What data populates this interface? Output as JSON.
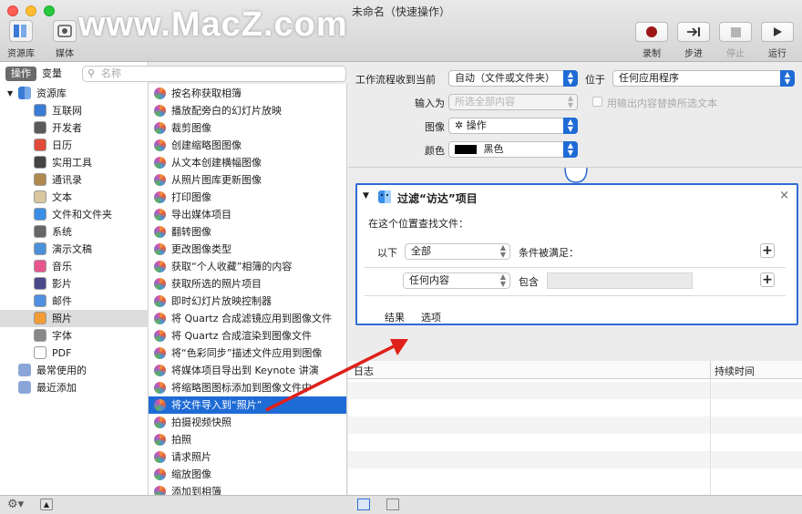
{
  "window": {
    "title": "未命名（快速操作）",
    "watermark": "www.MacZ.com"
  },
  "toolbar": {
    "left_buttons": [
      {
        "label": "资源库",
        "icon": "library-icon"
      },
      {
        "label": "媒体",
        "icon": "media-icon"
      }
    ],
    "right_buttons": [
      {
        "label": "录制",
        "icon": "record-icon"
      },
      {
        "label": "步进",
        "icon": "step-icon"
      },
      {
        "label": "停止",
        "icon": "stop-icon"
      },
      {
        "label": "运行",
        "icon": "run-icon"
      }
    ]
  },
  "library": {
    "tabs": [
      "操作",
      "变量"
    ],
    "search_placeholder": "名称",
    "root": "资源库",
    "items": [
      {
        "label": "互联网",
        "icon": "internet-icon",
        "color": "#3a7bd5"
      },
      {
        "label": "开发者",
        "icon": "developer-icon",
        "color": "#5a5a5a"
      },
      {
        "label": "日历",
        "icon": "calendar-icon",
        "color": "#e04b3a"
      },
      {
        "label": "实用工具",
        "icon": "utilities-icon",
        "color": "#444"
      },
      {
        "label": "通讯录",
        "icon": "contacts-icon",
        "color": "#b0894f"
      },
      {
        "label": "文本",
        "icon": "text-icon",
        "color": "#d9c7a0"
      },
      {
        "label": "文件和文件夹",
        "icon": "finder-icon",
        "color": "#3a8ee6"
      },
      {
        "label": "系统",
        "icon": "system-icon",
        "color": "#666"
      },
      {
        "label": "演示文稿",
        "icon": "presentation-icon",
        "color": "#4a90d9"
      },
      {
        "label": "音乐",
        "icon": "music-icon",
        "color": "#e8558e"
      },
      {
        "label": "影片",
        "icon": "movies-icon",
        "color": "#4a4a8a"
      },
      {
        "label": "邮件",
        "icon": "mail-icon",
        "color": "#4f8fe0"
      },
      {
        "label": "照片",
        "icon": "photos-icon",
        "color": "#f29c38",
        "selected": true
      },
      {
        "label": "字体",
        "icon": "fonts-icon",
        "color": "#888"
      },
      {
        "label": "PDF",
        "icon": "pdf-icon",
        "color": "#ffffff"
      }
    ],
    "smart": [
      {
        "label": "最常使用的",
        "icon": "smart-folder-icon"
      },
      {
        "label": "最近添加",
        "icon": "smart-folder-icon"
      }
    ]
  },
  "actions": {
    "items": [
      {
        "label": "按名称获取相簿"
      },
      {
        "label": "播放配旁白的幻灯片放映"
      },
      {
        "label": "裁剪图像"
      },
      {
        "label": "创建缩略图图像"
      },
      {
        "label": "从文本创建横幅图像"
      },
      {
        "label": "从照片图库更新图像"
      },
      {
        "label": "打印图像"
      },
      {
        "label": "导出媒体项目"
      },
      {
        "label": "翻转图像"
      },
      {
        "label": "更改图像类型"
      },
      {
        "label": "获取“个人收藏”相簿的内容"
      },
      {
        "label": "获取所选的照片项目"
      },
      {
        "label": "即时幻灯片放映控制器"
      },
      {
        "label": "将 Quartz 合成滤镜应用到图像文件"
      },
      {
        "label": "将 Quartz 合成渲染到图像文件"
      },
      {
        "label": "将“色彩同步”描述文件应用到图像"
      },
      {
        "label": "将媒体项目导出到 Keynote 讲演"
      },
      {
        "label": "将缩略图图标添加到图像文件中"
      },
      {
        "label": "将文件导入到“照片”",
        "selected": true
      },
      {
        "label": "拍摄视频快照"
      },
      {
        "label": "拍照"
      },
      {
        "label": "请求照片"
      },
      {
        "label": "缩放图像"
      },
      {
        "label": "添加到相簿"
      }
    ]
  },
  "workflow": {
    "receives_label": "工作流程收到当前",
    "receives_value": "自动（文件或文件夹）",
    "in_label": "位于",
    "in_value": "任何应用程序",
    "input_label": "输入为",
    "input_value": "所选全部内容",
    "replace_label": "用输出内容替换所选文本",
    "image_label": "图像",
    "image_value": "✲ 操作",
    "color_label": "颜色",
    "color_value": "黑色",
    "color_swatch": "#000000"
  },
  "action_box": {
    "title": "过滤“访达”项目",
    "find_label": "在这个位置查找文件：",
    "match_prefix": "以下",
    "match_value": "全部",
    "match_suffix": "条件被满足：",
    "criteria_value": "任何内容",
    "criteria_op": "包含",
    "tabs": [
      "结果",
      "选项"
    ]
  },
  "log": {
    "col_log": "日志",
    "col_duration": "持续时间"
  },
  "colors": {
    "accent": "#1f6bd6",
    "arrow": "#e0201a"
  }
}
